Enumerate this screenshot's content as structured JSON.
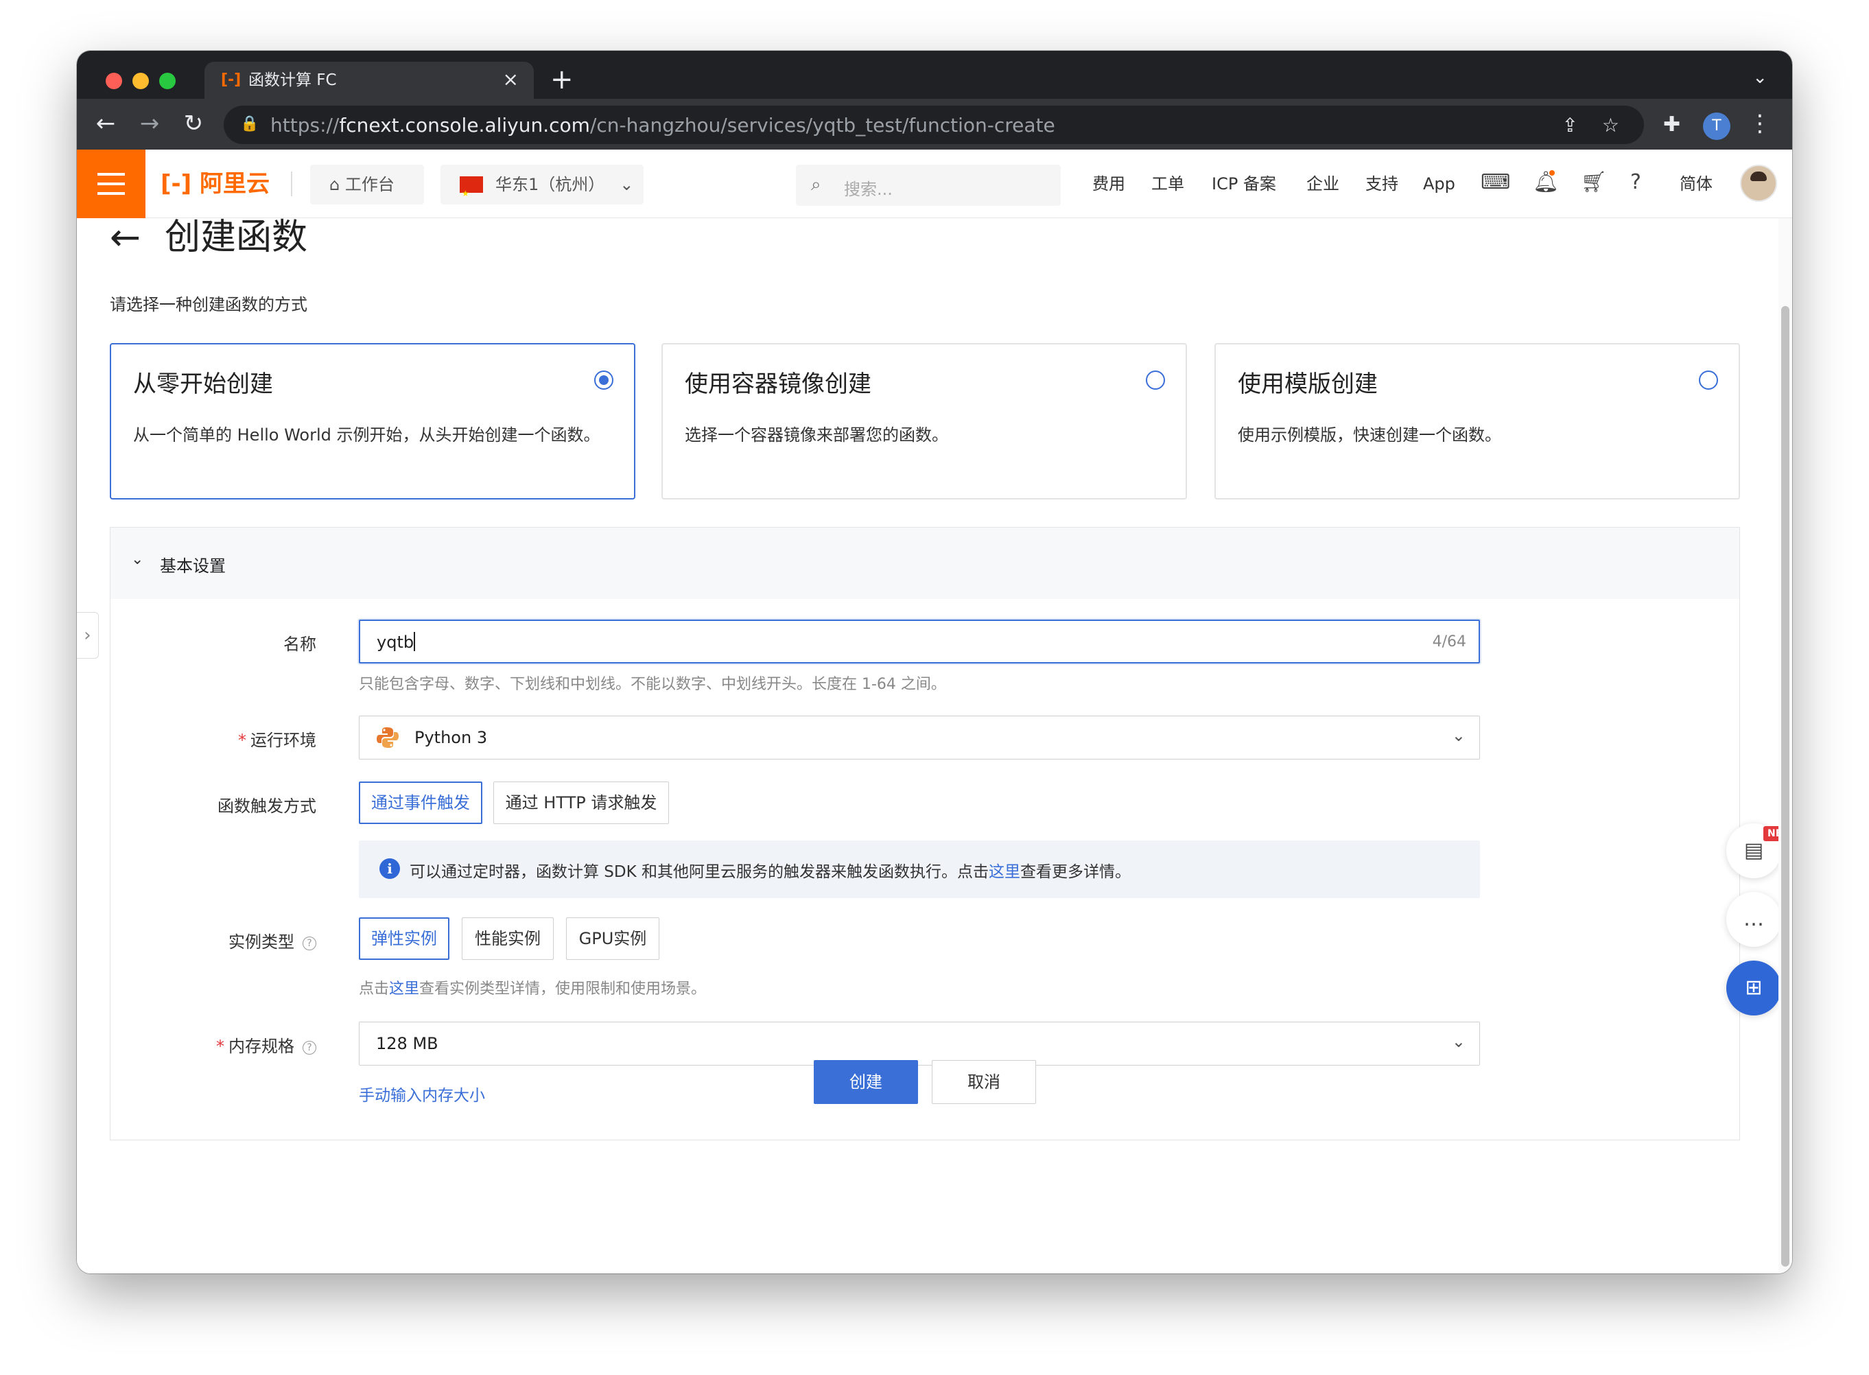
{
  "browser": {
    "tab_title": "函数计算 FC",
    "tab_favicon": "[-]",
    "tab_close": "×",
    "new_tab": "+",
    "url_scheme": "https://",
    "url_host": "fcnext.console.aliyun.com",
    "url_path": "/cn-hangzhou/services/yqtb_test/function-create",
    "profile_initial": "T"
  },
  "header": {
    "logo": "[-] 阿里云",
    "workbench": "工作台",
    "region": "华东1（杭州）",
    "search_placeholder": "搜索...",
    "links": [
      "费用",
      "工单",
      "ICP 备案",
      "企业",
      "支持",
      "App"
    ],
    "language": "简体"
  },
  "page": {
    "title": "创建函数",
    "subtitle": "请选择一种创建函数的方式",
    "modes": [
      {
        "title": "从零开始创建",
        "desc": "从一个简单的 Hello World 示例开始，从头开始创建一个函数。",
        "selected": true
      },
      {
        "title": "使用容器镜像创建",
        "desc": "选择一个容器镜像来部署您的函数。",
        "selected": false
      },
      {
        "title": "使用模版创建",
        "desc": "使用示例模版，快速创建一个函数。",
        "selected": false
      }
    ]
  },
  "form": {
    "section_title": "基本设置",
    "name_label": "名称",
    "name_value": "yqtb",
    "name_count": "4/64",
    "name_hint": "只能包含字母、数字、下划线和中划线。不能以数字、中划线开头。长度在 1-64 之间。",
    "runtime_label": "运行环境",
    "runtime_value": "Python 3",
    "trigger_label": "函数触发方式",
    "trigger_options": [
      "通过事件触发",
      "通过 HTTP 请求触发"
    ],
    "trigger_selected": "通过事件触发",
    "info_text_before": "可以通过定时器，函数计算 SDK 和其他阿里云服务的触发器来触发函数执行。点击",
    "info_link": "这里",
    "info_text_after": "查看更多详情。",
    "instance_label": "实例类型",
    "instance_options": [
      "弹性实例",
      "性能实例",
      "GPU实例"
    ],
    "instance_selected": "弹性实例",
    "instance_hint_before": "点击",
    "instance_hint_link": "这里",
    "instance_hint_after": "查看实例类型详情，使用限制和使用场景。",
    "memory_label": "内存规格",
    "memory_value": "128 MB",
    "memory_manual_link": "手动输入内存大小",
    "required_mark": "*",
    "help_mark": "?"
  },
  "actions": {
    "create": "创建",
    "cancel": "取消"
  },
  "floating": {
    "new_badge": "NEW"
  },
  "colors": {
    "brand": "#ff6a00",
    "primary": "#3a6fd8",
    "required": "#e4393c"
  }
}
